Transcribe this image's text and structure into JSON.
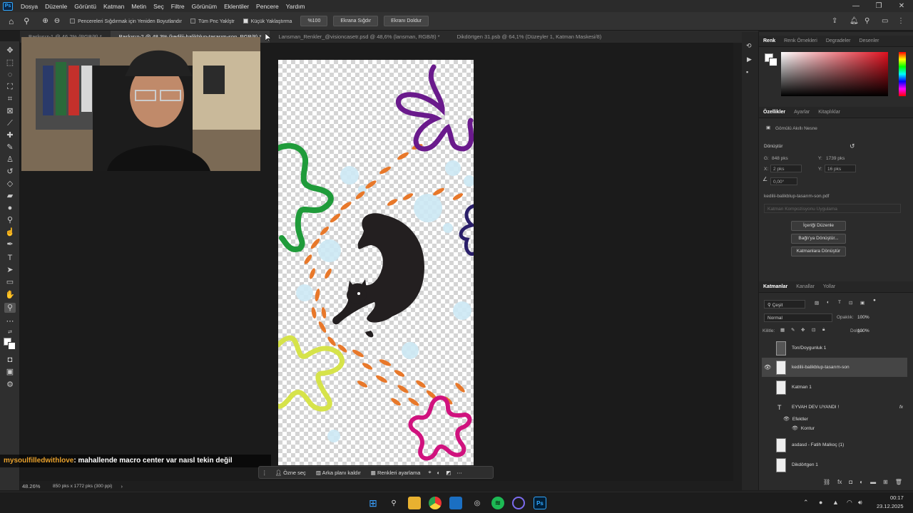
{
  "app": {
    "logo": "Ps"
  },
  "menu": [
    "Dosya",
    "Düzenle",
    "Görüntü",
    "Katman",
    "Metin",
    "Seç",
    "Filtre",
    "Görünüm",
    "Eklentiler",
    "Pencere",
    "Yardım"
  ],
  "window_controls": {
    "minimize": "—",
    "maximize": "❐",
    "close": "✕"
  },
  "options": {
    "resize_windows": "Pencereleri Sığdırmak için Yeniden Boyutlandır",
    "zoom_all": "Tüm Pnc Yaklştr",
    "scrubby_zoom": "Küçük Yaklaştırma",
    "zoom_value": "%100",
    "fit_screen": "Ekrana Sığdır",
    "fill_screen": "Ekranı Doldur"
  },
  "tabs": [
    {
      "label": "Baskısız-1 @ 46,2% (RGB/8) *"
    },
    {
      "label": "Baskısız-2 @ 48,3% (kedilii-balikblup-tasarım-son, RGB/8) *",
      "active": true
    },
    {
      "label": "Lansman_Renkler_@visioncasetr.psd @ 48,6% (lansman, RGB/8) *"
    },
    {
      "label": "Dikdörtgen 31.psb @ 64,1% (Düzeyler 1, Katman Maskesi/8)"
    }
  ],
  "chat": {
    "user": "mysoulfilledwithlove",
    "message": ": mahallende macro center var naısl tekin değil"
  },
  "context_bar": {
    "select_subject": "Özne seç",
    "remove_bg": "Arka planı kaldır",
    "adjust_colors": "Renkleri ayarlama"
  },
  "status": {
    "zoom": "48.26%",
    "doc_info": "850 pks x 1772 pks (300 ppi)"
  },
  "color_panel": {
    "tabs": [
      "Renk",
      "Renk Örnekleri",
      "Degradeler",
      "Desenler"
    ],
    "active": "Renk",
    "hue": "#e0101e"
  },
  "properties": {
    "tabs": [
      "Özellikler",
      "Ayarlar",
      "Kitaplıklar"
    ],
    "type": "Gömülü Akıllı Nesne",
    "transform_title": "Dönüştür",
    "w_label": "G:",
    "w_value": "848 pks",
    "h_label": "Y:",
    "h_value": "1739 pks",
    "x_label": "X:",
    "x_value": "2 pks",
    "y_label": "Y:",
    "y_value": "16 pks",
    "angle": "0,00°",
    "file": "kedilii-balikblup-tasarım-son.pdf",
    "layer_comp": "Katman Kompozisyonu Uygulama",
    "edit_contents": "İçeriği Düzenle",
    "convert_linked": "Bağlı'ya Dönüştür...",
    "convert_layers": "Katmanlara Dönüştür"
  },
  "layers_panel": {
    "tabs": [
      "Katmanlar",
      "Kanallar",
      "Yollar"
    ],
    "filter": "Çeşit",
    "blend": "Normal",
    "opacity_label": "Opaklık:",
    "opacity": "100%",
    "lock_label": "Kilitle:",
    "fill_label": "Dolgu:",
    "fill": "100%",
    "layers": [
      {
        "name": "Ton/Doygunluk 1"
      },
      {
        "name": "kedilii-balikblup-tasarım-son",
        "selected": true
      },
      {
        "name": "Katman 1"
      },
      {
        "name": "EYVAH DEV UYANDI  !"
      },
      {
        "name": "Efektler"
      },
      {
        "name": "Kontur"
      },
      {
        "name": "asdasd - Fatih Malkoç (1)"
      },
      {
        "name": "Dikdörtgen 1"
      }
    ],
    "fx": "fx"
  },
  "taskbar": {
    "time": "00:17",
    "date": "23.12.2025"
  }
}
